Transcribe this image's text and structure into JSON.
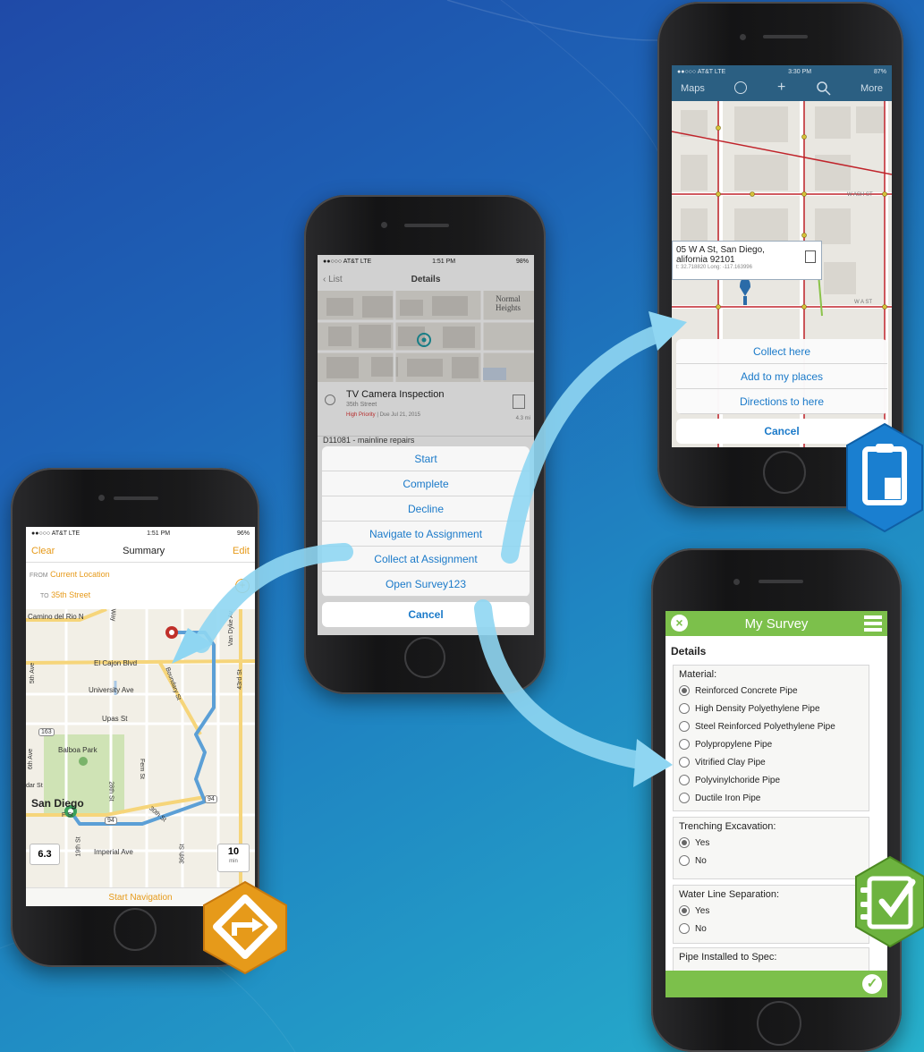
{
  "summary_phone": {
    "status": {
      "carrier": "●●○○○ AT&T  LTE",
      "time": "1:51 PM",
      "battery": "96%"
    },
    "nav": {
      "clear": "Clear",
      "title": "Summary",
      "edit": "Edit"
    },
    "from_label": "FROM",
    "from_value": "Current Location",
    "to_label": "TO",
    "to_value": "35th Street",
    "map_labels": {
      "camino": "Camino del Rio N",
      "el_cajon": "El Cajon Blvd",
      "university": "University Ave",
      "upas": "Upas St",
      "balboa": "Balboa Park",
      "san_diego": "San Diego",
      "imperial": "Imperial Ave",
      "fst": "F St",
      "dar": "dar St",
      "fern": "Fern St",
      "way": "Way",
      "boundary": "Boundary St",
      "vandyke": "Van Dyke Av",
      "s43": "43rd St",
      "s5": "5th Ave",
      "s6": "6th Ave",
      "s19": "19th St",
      "s28": "28th St",
      "s30": "30th St",
      "s36": "36th St",
      "r163": "163",
      "r94a": "94",
      "r94b": "94"
    },
    "distance": "6.3",
    "minutes": "10",
    "min_unit": "min",
    "start_navigation": "Start Navigation"
  },
  "details_phone": {
    "status": {
      "carrier": "●●○○○ AT&T  LTE",
      "time": "1:51 PM",
      "battery": "98%"
    },
    "nav": {
      "back": "List",
      "title": "Details"
    },
    "map_labels": {
      "normal_heights": "Normal Heights"
    },
    "assignment": {
      "title": "TV Camera Inspection",
      "street": "35th Street",
      "priority": "High Priority",
      "due": "Due Jul 21, 2015",
      "distance": "4.3 mi"
    },
    "work_order": "D11081 - mainline repairs",
    "actions": [
      "Start",
      "Complete",
      "Decline",
      "Navigate to Assignment",
      "Collect at Assignment",
      "Open Survey123"
    ],
    "cancel": "Cancel"
  },
  "collector_phone": {
    "status": {
      "carrier": "●●○○○ AT&T  LTE",
      "time": "3:30 PM",
      "battery": "87%"
    },
    "nav": {
      "maps": "Maps",
      "more": "More"
    },
    "map_labels": {
      "street1": "W ASH ST",
      "street2": "W A ST"
    },
    "callout": {
      "line1": "05 W A St, San Diego,",
      "line2": "alifornia 92101",
      "line3": "t: 32.718820  Long: -117.163996"
    },
    "actions": [
      "Collect here",
      "Add to my places",
      "Directions to here"
    ],
    "cancel": "Cancel"
  },
  "survey_phone": {
    "header_title": "My Survey",
    "section": "Details",
    "material_label": "Material:",
    "material_options": [
      "Reinforced Concrete Pipe",
      "High Density Polyethylene Pipe",
      "Steel Reinforced Polyethylene Pipe",
      "Polypropylene Pipe",
      "Vitrified Clay Pipe",
      "Polyvinylchoride Pipe",
      "Ductile Iron Pipe"
    ],
    "material_selected": "Reinforced Concrete Pipe",
    "trenching_label": "Trenching Excavation:",
    "trenching_options": [
      "Yes",
      "No"
    ],
    "trenching_selected": "Yes",
    "water_label": "Water Line Separation:",
    "water_options": [
      "Yes",
      "No"
    ],
    "water_selected": "Yes",
    "pipe_label": "Pipe Installed to Spec:"
  },
  "colors": {
    "accent_blue": "#1b7ac9",
    "survey_green": "#7cc04b",
    "nav_orange": "#e69a1a",
    "route_blue": "#5b9fd6",
    "arrow_cyan": "#8fd6f2"
  }
}
